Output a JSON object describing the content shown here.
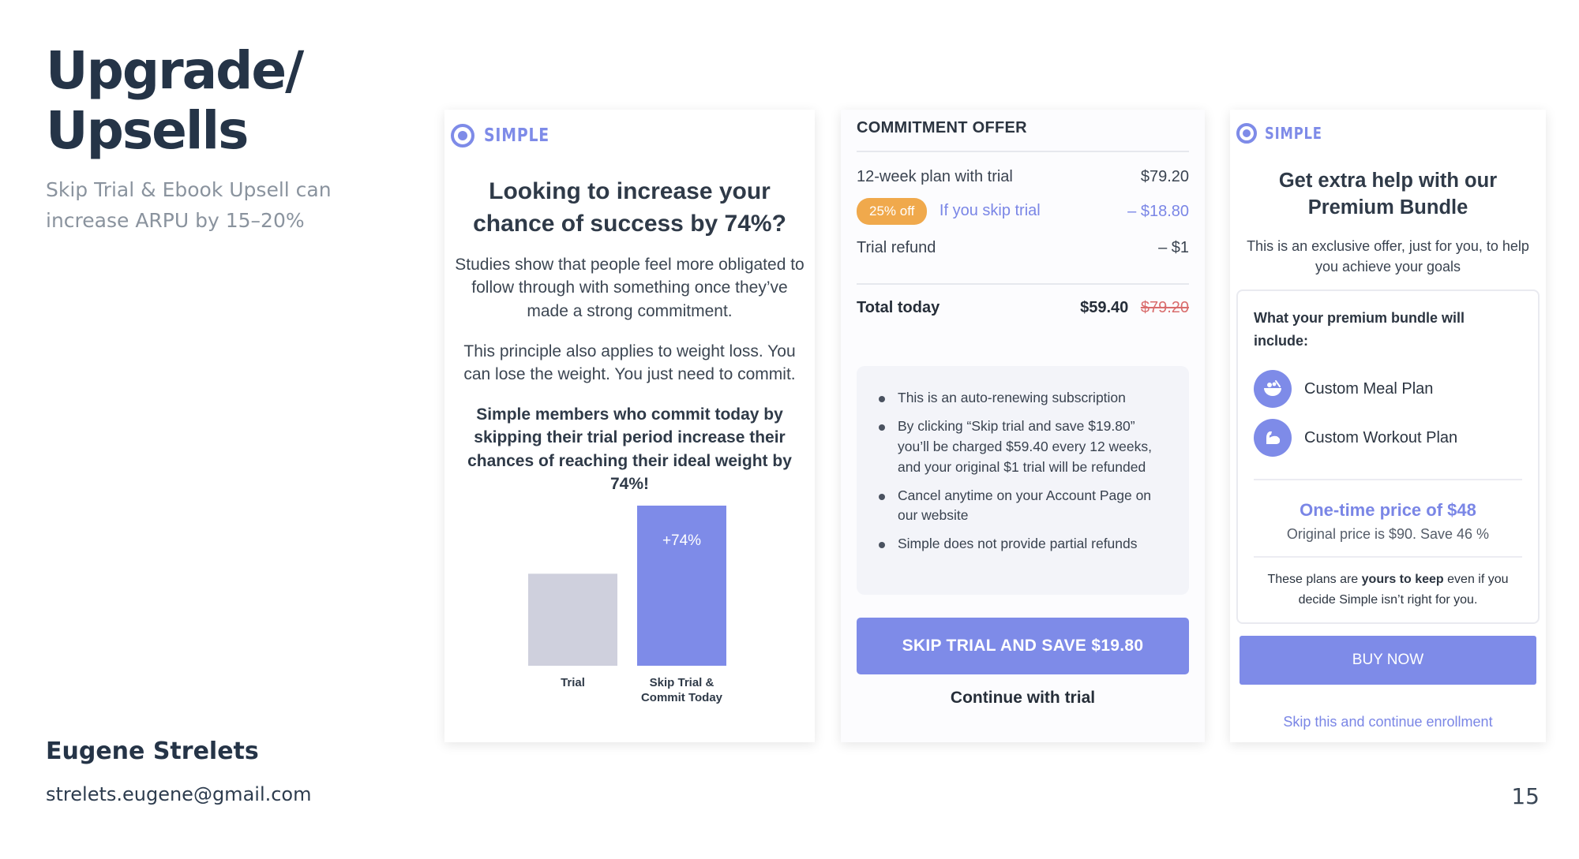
{
  "slide": {
    "title_line1": "Upgrade/",
    "title_line2": "Upsells",
    "subtitle": "Skip Trial & Ebook Upsell can increase ARPU by 15–20%",
    "author_name": "Eugene Strelets",
    "author_email": "strelets.eugene@gmail.com",
    "page_number": "15"
  },
  "colors": {
    "accent": "#7e8be8",
    "badge": "#f0a94c",
    "strike": "#d96d6d",
    "trial_bar": "#cfd0dd"
  },
  "screen_skip_trial_info": {
    "logo_text": "SIMPLE",
    "logo_icon": "target-icon",
    "heading": "Looking to increase your chance of success by 74%?",
    "paragraph1": "Studies show that people feel more obligated to follow through with something once they’ve made a strong commitment.",
    "paragraph2": "This principle also applies to weight loss. You can lose the weight. You just need to commit.",
    "bold_paragraph": "Simple members who commit today by skipping their trial period increase their chances of reaching their ideal weight by 74%!"
  },
  "chart_data": {
    "type": "bar",
    "categories": [
      "Trial",
      "Skip Trial & Commit Today"
    ],
    "category_lines": [
      [
        "Trial"
      ],
      [
        "Skip Trial &",
        "Commit Today"
      ]
    ],
    "values": [
      1,
      1.74
    ],
    "value_labels": [
      "",
      "+74%"
    ],
    "colors": [
      "#cfd0dd",
      "#7e8be8"
    ],
    "grid": false
  },
  "screen_commitment_offer": {
    "title": "COMMITMENT OFFER",
    "plan_label": "12-week plan with trial",
    "plan_price": "$79.20",
    "badge": "25% off",
    "skip_label": "If you skip trial",
    "skip_discount": "– $18.80",
    "refund_label": "Trial refund",
    "refund_amount": "– $1",
    "total_label": "Total today",
    "total_price": "$59.40",
    "total_old_price": "$79.20",
    "terms": [
      "This is an auto-renewing subscription",
      "By clicking “Skip trial and save $19.80” you’ll be charged $59.40 every 12 weeks, and your original $1 trial will be refunded",
      "Cancel anytime on your Account Page on our website",
      "Simple does not provide partial refunds"
    ],
    "primary_button": "SKIP TRIAL AND SAVE $19.80",
    "secondary_button": "Continue with trial"
  },
  "screen_premium_bundle": {
    "logo_text": "SIMPLE",
    "heading": "Get extra help with our Premium Bundle",
    "intro": "This is an exclusive offer, just for you, to help you achieve your goals",
    "include_title": "What your premium bundle will include:",
    "features": [
      {
        "label": "Custom Meal Plan",
        "icon": "meal-bowl-icon"
      },
      {
        "label": "Custom Workout Plan",
        "icon": "flexed-arm-icon"
      }
    ],
    "one_time_price": "One-time price of $48",
    "original_price": "Original price is $90. Save 46 %",
    "keep_note_prefix": "These plans are",
    "keep_note_bold": "yours to keep",
    "keep_note_suffix": "even if you decide Simple isn’t right for you.",
    "buy_button": "BUY NOW",
    "skip_link": "Skip this and continue enrollment"
  }
}
